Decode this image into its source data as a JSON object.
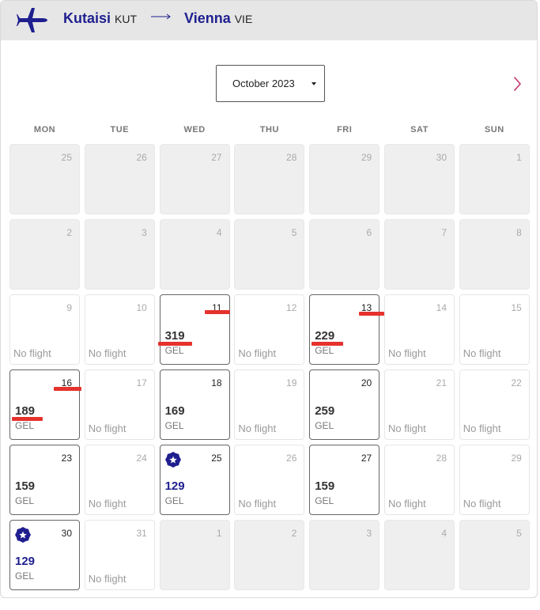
{
  "header": {
    "origin_city": "Kutaisi",
    "origin_code": "KUT",
    "destination_city": "Vienna",
    "destination_code": "VIE",
    "icon": "airplane-icon"
  },
  "month_select": {
    "value": "October 2023"
  },
  "next_icon": "chevron-right-icon",
  "accent_color": "#1f1f8f",
  "weekdays": [
    "MON",
    "TUE",
    "WED",
    "THU",
    "FRI",
    "SAT",
    "SUN"
  ],
  "calendar": [
    {
      "day": "25",
      "state": "outside"
    },
    {
      "day": "26",
      "state": "outside"
    },
    {
      "day": "27",
      "state": "outside"
    },
    {
      "day": "28",
      "state": "outside"
    },
    {
      "day": "29",
      "state": "outside"
    },
    {
      "day": "30",
      "state": "outside"
    },
    {
      "day": "1",
      "state": "past"
    },
    {
      "day": "2",
      "state": "past"
    },
    {
      "day": "3",
      "state": "past"
    },
    {
      "day": "4",
      "state": "past"
    },
    {
      "day": "5",
      "state": "past"
    },
    {
      "day": "6",
      "state": "past"
    },
    {
      "day": "7",
      "state": "past"
    },
    {
      "day": "8",
      "state": "past"
    },
    {
      "day": "9",
      "state": "noflight",
      "label": "No flight"
    },
    {
      "day": "10",
      "state": "noflight",
      "label": "No flight"
    },
    {
      "day": "11",
      "state": "priced",
      "price": "319",
      "currency": "GEL"
    },
    {
      "day": "12",
      "state": "noflight",
      "label": "No flight"
    },
    {
      "day": "13",
      "state": "priced",
      "price": "229",
      "currency": "GEL"
    },
    {
      "day": "14",
      "state": "noflight",
      "label": "No flight"
    },
    {
      "day": "15",
      "state": "noflight",
      "label": "No flight"
    },
    {
      "day": "16",
      "state": "priced",
      "price": "189",
      "currency": "GEL"
    },
    {
      "day": "17",
      "state": "noflight",
      "label": "No flight"
    },
    {
      "day": "18",
      "state": "priced",
      "price": "169",
      "currency": "GEL"
    },
    {
      "day": "19",
      "state": "noflight",
      "label": "No flight"
    },
    {
      "day": "20",
      "state": "priced",
      "price": "259",
      "currency": "GEL"
    },
    {
      "day": "21",
      "state": "noflight",
      "label": "No flight"
    },
    {
      "day": "22",
      "state": "noflight",
      "label": "No flight"
    },
    {
      "day": "23",
      "state": "priced",
      "price": "159",
      "currency": "GEL"
    },
    {
      "day": "24",
      "state": "noflight",
      "label": "No flight"
    },
    {
      "day": "25",
      "state": "priced",
      "price": "129",
      "currency": "GEL",
      "best": true
    },
    {
      "day": "26",
      "state": "noflight",
      "label": "No flight"
    },
    {
      "day": "27",
      "state": "priced",
      "price": "159",
      "currency": "GEL"
    },
    {
      "day": "28",
      "state": "noflight",
      "label": "No flight"
    },
    {
      "day": "29",
      "state": "noflight",
      "label": "No flight"
    },
    {
      "day": "30",
      "state": "priced",
      "price": "129",
      "currency": "GEL",
      "best": true
    },
    {
      "day": "31",
      "state": "noflight",
      "label": "No flight"
    },
    {
      "day": "1",
      "state": "outside"
    },
    {
      "day": "2",
      "state": "outside"
    },
    {
      "day": "3",
      "state": "outside"
    },
    {
      "day": "4",
      "state": "outside"
    },
    {
      "day": "5",
      "state": "outside"
    }
  ],
  "annotation_color": "#e5322d"
}
